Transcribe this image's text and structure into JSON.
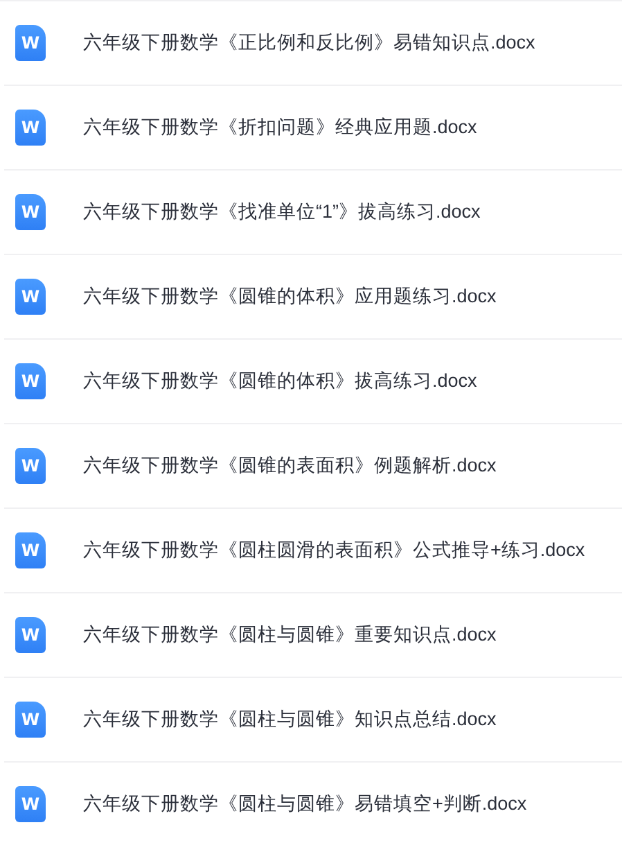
{
  "files": [
    {
      "name": "六年级下册数学《正比例和反比例》易错知识点.docx",
      "icon_label": "W"
    },
    {
      "name": "六年级下册数学《折扣问题》经典应用题.docx",
      "icon_label": "W"
    },
    {
      "name": "六年级下册数学《找准单位“1”》拔高练习.docx",
      "icon_label": "W"
    },
    {
      "name": "六年级下册数学《圆锥的体积》应用题练习.docx",
      "icon_label": "W"
    },
    {
      "name": "六年级下册数学《圆锥的体积》拔高练习.docx",
      "icon_label": "W"
    },
    {
      "name": "六年级下册数学《圆锥的表面积》例题解析.docx",
      "icon_label": "W"
    },
    {
      "name": "六年级下册数学《圆柱圆滑的表面积》公式推导+练习.docx",
      "icon_label": "W"
    },
    {
      "name": "六年级下册数学《圆柱与圆锥》重要知识点.docx",
      "icon_label": "W"
    },
    {
      "name": "六年级下册数学《圆柱与圆锥》知识点总结.docx",
      "icon_label": "W"
    },
    {
      "name": "六年级下册数学《圆柱与圆锥》易错填空+判断.docx",
      "icon_label": "W"
    }
  ]
}
